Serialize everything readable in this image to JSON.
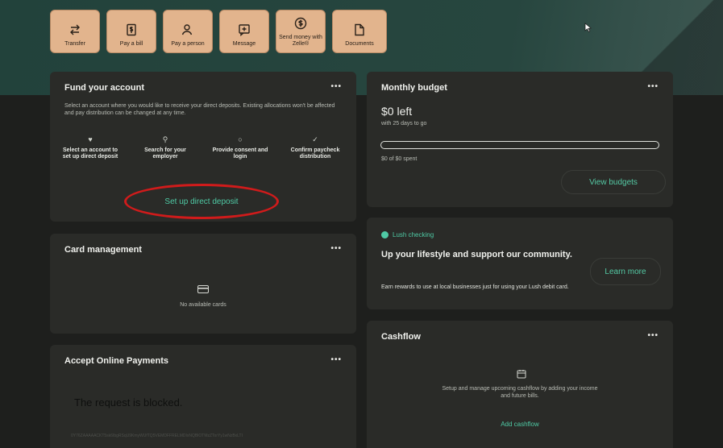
{
  "quick_actions": [
    {
      "label": "Transfer",
      "icon": "transfer-icon"
    },
    {
      "label": "Pay a bill",
      "icon": "bill-icon"
    },
    {
      "label": "Pay a person",
      "icon": "person-icon"
    },
    {
      "label": "Message",
      "icon": "message-icon"
    },
    {
      "label": "Send money with Zelle®",
      "icon": "zelle-icon"
    },
    {
      "label": "Documents",
      "icon": "document-icon"
    }
  ],
  "fund": {
    "title": "Fund your account",
    "menu": "•••",
    "description": "Select an account where you would like to receive your direct deposits. Existing allocations won't be affected and pay distribution can be changed at any time.",
    "steps": [
      {
        "label": "Select an account to set up direct deposit",
        "icon": "piggy-icon"
      },
      {
        "label": "Search for your employer",
        "icon": "search-icon"
      },
      {
        "label": "Provide consent and login",
        "icon": "lock-icon"
      },
      {
        "label": "Confirm paycheck distribution",
        "icon": "check-circle-icon"
      }
    ],
    "button": "Set up direct deposit"
  },
  "card_mgmt": {
    "title": "Card management",
    "menu": "•••",
    "empty": "No available cards"
  },
  "payments": {
    "title": "Accept Online Payments",
    "menu": "•••",
    "blocked": "The request is blocked.",
    "code": "0Y76ZAAAAACKT5sk6IbgRSqU9KmyWUfTQ5VEMDFFRELMDIxNQBlOTMzZTorYy1wNzBxLTI"
  },
  "budget": {
    "title": "Monthly budget",
    "menu": "•••",
    "left": "$0 left",
    "days": "with 25 days to go",
    "spent": "$0 of $0 spent",
    "button": "View budgets",
    "progress": 0
  },
  "lush": {
    "tag": "Lush checking",
    "headline": "Up your lifestyle and support our community.",
    "body": "Earn rewards to use at local businesses just for using your Lush debit card.",
    "button": "Learn more"
  },
  "cashflow": {
    "title": "Cashflow",
    "menu": "•••",
    "body": "Setup and manage upcoming cashflow by adding your income and future bills.",
    "button": "Add cashflow"
  },
  "colors": {
    "accent": "#4fcaa5",
    "quick_action_bg": "#e2b48d",
    "annotation": "#d01b1b"
  }
}
